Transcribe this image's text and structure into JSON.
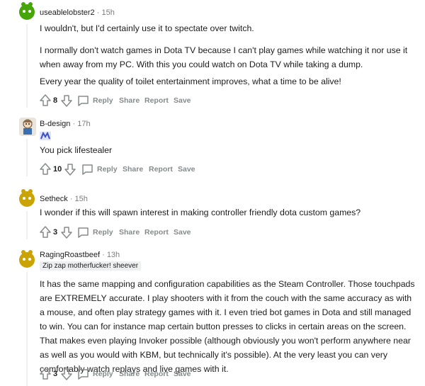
{
  "comments": [
    {
      "username": "useablelobster2",
      "sep": "·",
      "time": "15h",
      "paragraphs": [
        "I wouldn't, but I'd certainly use it to spectate over twitch.",
        "I normally don't watch games in Dota TV because I can't play games while watching it nor use it when away from my PC. With this you could watch on Dota TV while taking a dump.",
        "Every year the quality of toilet entertainment improves, what a time to be alive!"
      ],
      "score": "8",
      "reply": "Reply",
      "share": "Share",
      "report": "Report",
      "save": "Save"
    },
    {
      "username": "B-design",
      "sep": "·",
      "time": "17h",
      "paragraphs": [
        "You pick lifestealer"
      ],
      "score": "10",
      "reply": "Reply",
      "share": "Share",
      "report": "Report",
      "save": "Save"
    },
    {
      "username": "Setheck",
      "sep": "·",
      "time": "15h",
      "paragraphs": [
        "I wonder if this will spawn interest in making controller friendly dota custom games?"
      ],
      "score": "3",
      "reply": "Reply",
      "share": "Share",
      "report": "Report",
      "save": "Save"
    },
    {
      "username": "RagingRoastbeef",
      "sep": "·",
      "time": "13h",
      "flair": "Zip zap motherfucker! sheever",
      "paragraphs": [
        "It has the same mapping and configuration capabilities as the Steam Controller. Those touchpads are EXTREMELY accurate. I play shooters with it from the couch with the same accuracy as with a mouse, and often play strategy games with it. I even tried bot games in Dota and still managed to win. You can for instance map certain button presses to clicks in certain areas on the screen. That makes even playing Invoker possible (although obviously you won't perform anywhere near as well as you would with KBM, but technically it's possible). At the very least you can very comfortably watch replays and live games with it."
      ],
      "score": "3",
      "reply": "Reply",
      "share": "Share",
      "report": "Report",
      "save": "Save"
    }
  ],
  "colors": {
    "text": "#1c1c1c",
    "muted": "#878a8c",
    "green_avatar": "#46a508",
    "yellow_avatar": "#c9a404"
  },
  "icons": [
    "upvote-icon",
    "downvote-icon",
    "comment-bubble-icon",
    "dota-flair-icon"
  ]
}
